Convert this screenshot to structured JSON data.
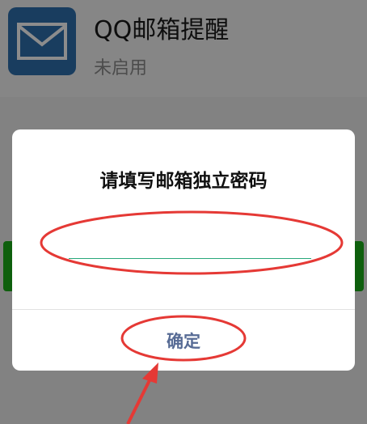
{
  "app": {
    "title": "QQ邮箱提醒",
    "status": "未启用",
    "icon": "mail-envelope-icon"
  },
  "dialog": {
    "title": "请填写邮箱独立密码",
    "input": {
      "value": "",
      "placeholder": ""
    },
    "confirm_label": "确定"
  },
  "colors": {
    "icon_bg": "#2f6fae",
    "confirm_text": "#576b95",
    "input_underline": "#28a87a",
    "annotation": "#e53935",
    "bg_button": "#1aad19"
  }
}
